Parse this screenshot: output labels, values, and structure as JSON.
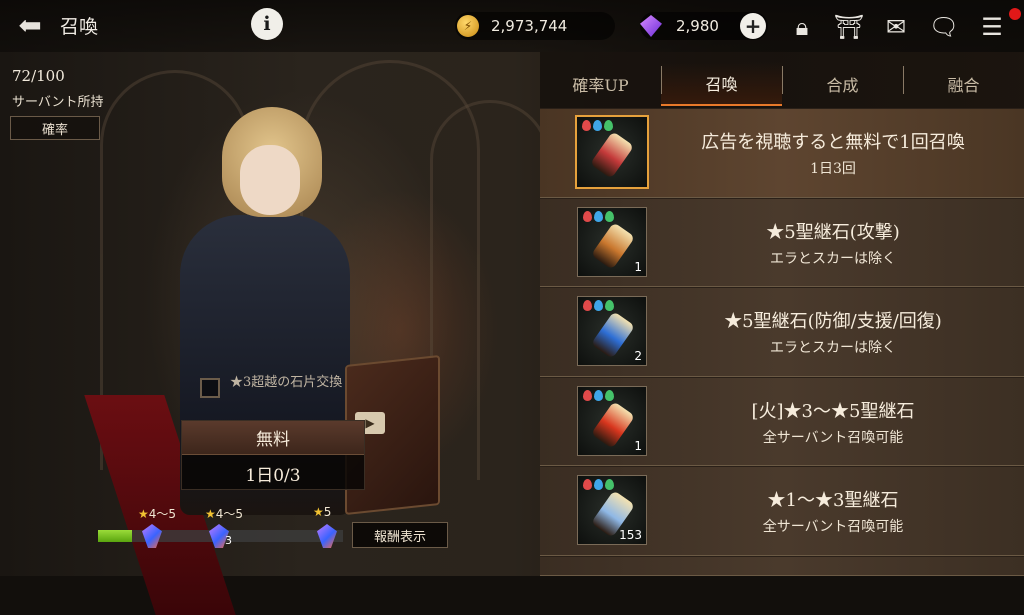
{
  "header": {
    "back_icon": "back-arrow-icon",
    "title": "召喚",
    "info_label": "i",
    "gold": "2,973,744",
    "gems": "2,980",
    "plus_label": "+",
    "icons": [
      "lock-icon",
      "gate-icon",
      "mail-icon",
      "chat-icon",
      "menu-icon"
    ]
  },
  "left": {
    "owned_count": "72/100",
    "owned_label": "サーバント所持",
    "probability_label": "確率",
    "exchange_label": "★3超越の石片交換",
    "free_label": "無料",
    "daily_label": "1日0/3",
    "reward_label": "報酬表示",
    "progress": {
      "fill_fraction": 0.14,
      "milestones": [
        {
          "stars": "★",
          "range": "4～5",
          "count": ""
        },
        {
          "stars": "★",
          "range": "4～5",
          "count": "3"
        },
        {
          "stars": "★",
          "range": "5",
          "count": ""
        }
      ]
    }
  },
  "tabs": [
    {
      "label": "確率UP",
      "active": false
    },
    {
      "label": "召喚",
      "active": true
    },
    {
      "label": "合成",
      "active": false
    },
    {
      "label": "融合",
      "active": false
    }
  ],
  "summon_list": [
    {
      "title": "広告を視聴すると無料で1回召喚",
      "subtitle": "1日3回",
      "count": "",
      "selected": true,
      "color": "#c43a3a"
    },
    {
      "title": "★5聖継石(攻撃)",
      "subtitle": "エラとスカーは除く",
      "count": "1",
      "selected": false,
      "color": "#c9772e"
    },
    {
      "title": "★5聖継石(防御/支援/回復)",
      "subtitle": "エラとスカーは除く",
      "count": "2",
      "selected": false,
      "color": "#2e6fd6"
    },
    {
      "title": "[火]★3～★5聖継石",
      "subtitle": "全サーバント召喚可能",
      "count": "1",
      "selected": false,
      "color": "#d8361e"
    },
    {
      "title": "★1～★3聖継石",
      "subtitle": "全サーバント召喚可能",
      "count": "153",
      "selected": false,
      "color": "#8fb8e6"
    }
  ]
}
